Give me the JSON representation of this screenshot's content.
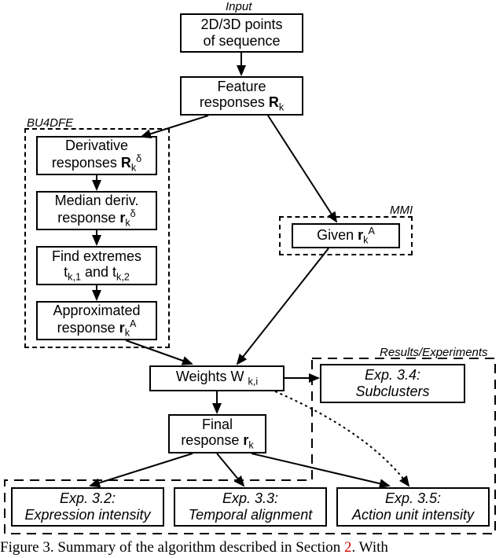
{
  "labels": {
    "input": "Input",
    "bu4dfe": "BU4DFE",
    "mmi": "MMI",
    "results": "Results/Experiments"
  },
  "boxes": {
    "points": {
      "l1": "2D/3D  points",
      "l2": "of  sequence"
    },
    "feat": {
      "l1": "Feature",
      "l2_a": "responses  ",
      "l2_b": "R",
      "l2_sub": "k"
    },
    "deriv": {
      "l1": "Derivative",
      "l2_a": "responses  ",
      "l2_b": "R",
      "l2_sub": "k",
      "l2_sup": "δ"
    },
    "median": {
      "l1": "Median  deriv.",
      "l2_a": "response  ",
      "l2_b": "r",
      "l2_sub": "k",
      "l2_sup": "δ"
    },
    "extremes": {
      "l1": "Find  extremes",
      "l2_a": "t",
      "l2_b": "k,1",
      "l2_c": "  and  t",
      "l2_d": "k,2"
    },
    "approx": {
      "l1": "Approximated",
      "l2_a": "response  ",
      "l2_b": "r",
      "l2_sub": "k",
      "l2_sup": "A"
    },
    "given": {
      "l1_a": "Given  ",
      "l1_b": "r",
      "l1_sub": "k",
      "l1_sup": "A"
    },
    "weights": {
      "l1_a": "Weights  W ",
      "l1_sub": "k,i"
    },
    "final": {
      "l1": "Final",
      "l2_a": "response  ",
      "l2_b": "r",
      "l2_sub": "k"
    },
    "exp32": {
      "l1": "Exp.  3.2:",
      "l2": "Expression  intensity"
    },
    "exp33": {
      "l1": "Exp.  3.3:",
      "l2": "Temporal  alignment"
    },
    "exp34": {
      "l1": "Exp.  3.4:",
      "l2": "Subclusters"
    },
    "exp35": {
      "l1": "Exp.  3.5:",
      "l2": "Action  unit  intensity"
    }
  },
  "caption": {
    "prefix": "Figure 3. Summary of the algorithm described in Section ",
    "section": "2",
    "suffix": " With"
  }
}
